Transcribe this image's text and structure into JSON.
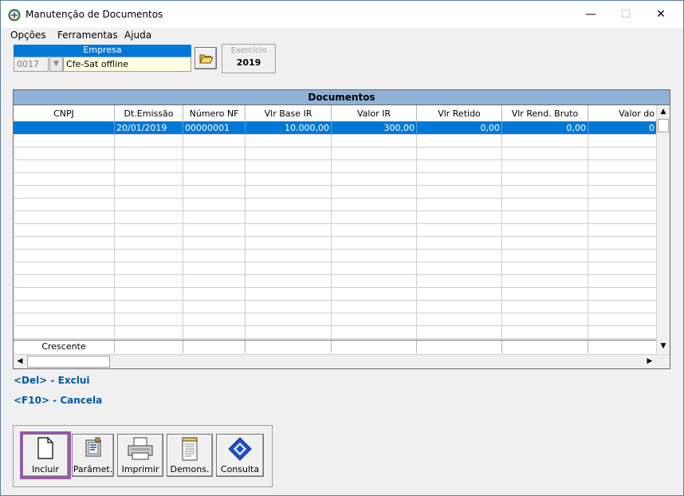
{
  "window": {
    "title": "Manutenção de Documentos",
    "min_glyph": "—",
    "max_glyph": "☐",
    "close_glyph": "✕"
  },
  "menu": [
    {
      "label": "Opções"
    },
    {
      "label": "Ferramentas"
    },
    {
      "label": "Ajuda"
    }
  ],
  "empresa": {
    "label": "Empresa",
    "code": "0017",
    "name": "Cfe-Sat offline"
  },
  "exercicio": {
    "label": "Exercício",
    "value": "2019"
  },
  "grid": {
    "title": "Documentos",
    "columns": [
      "CNPJ",
      "Dt.Emissão",
      "Número NF",
      "Vlr Base IR",
      "Valor IR",
      "Vlr Retido",
      "Vlr Rend. Bruto",
      "Valor do"
    ],
    "rows": [
      {
        "cnpj": "",
        "dt_emissao": "20/01/2019",
        "numero_nf": "00000001",
        "vlr_base_ir": "10.000,00",
        "valor_ir": "300,00",
        "vlr_retido": "0,00",
        "vlr_rend_bruto": "0,00",
        "valor_do": "0"
      }
    ],
    "footer": "Crescente"
  },
  "hints": {
    "del": "<Del> - Exclui",
    "f10": "<F10> - Cancela"
  },
  "toolbar": [
    {
      "label": "Incluir",
      "icon": "new-document-icon"
    },
    {
      "label": "Parâmet.",
      "icon": "parameters-icon"
    },
    {
      "label": "Imprimir",
      "icon": "printer-icon"
    },
    {
      "label": "Demons.",
      "icon": "statement-icon"
    },
    {
      "label": "Consulta",
      "icon": "query-icon"
    }
  ],
  "colors": {
    "selection": "#0078d7",
    "grid_title_bg": "#8fb1d6",
    "hint_text": "#0058a8",
    "active_outline": "#a152b9"
  }
}
